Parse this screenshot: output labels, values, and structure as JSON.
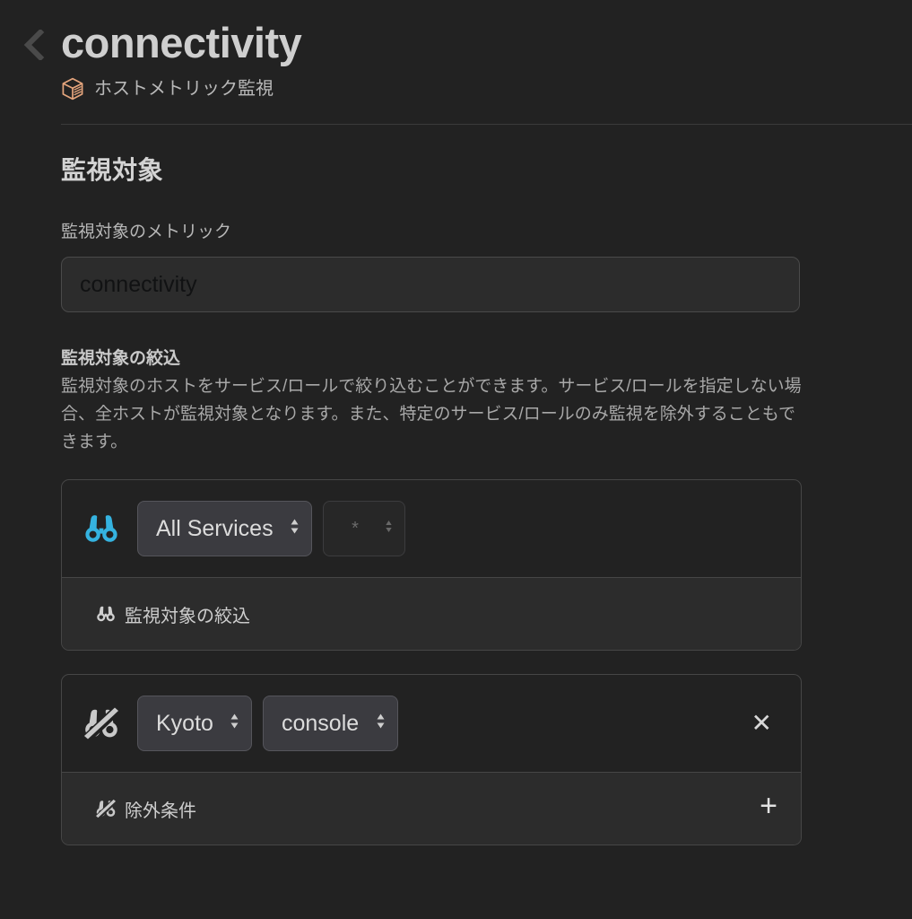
{
  "header": {
    "back_icon": "chevron-left-icon",
    "title": "connectivity",
    "badge_icon": "cube-icon",
    "badge_color": "#e5a57d",
    "subtitle": "ホストメトリック監視"
  },
  "main": {
    "section_title": "監視対象",
    "metric": {
      "label": "監視対象のメトリック",
      "value": "connectivity",
      "placeholder": "connectivity"
    },
    "scope": {
      "heading": "監視対象の絞込",
      "description": "監視対象のホストをサービス/ロールで絞り込むことができます。サービス/ロールを指定しない場合、全ホストが監視対象となります。また、特定のサービス/ロールのみ監視を除外することもできます。"
    },
    "include_panel": {
      "icon": "binoculars-icon",
      "icon_color": "#35b3e0",
      "service_value": "All Services",
      "role_value": "*",
      "role_disabled": true,
      "footer_icon": "binoculars-icon",
      "footer_label": "監視対象の絞込"
    },
    "exclude_panel": {
      "icon": "binoculars-slash-icon",
      "icon_color": "#c9c9c9",
      "service_value": "Kyoto",
      "role_value": "console",
      "remove_label": "✕",
      "footer_icon": "binoculars-slash-icon",
      "footer_label": "除外条件",
      "add_label": "+"
    }
  },
  "colors": {
    "background": "#222222",
    "panel_footer": "#2c2c2c",
    "border": "#464646",
    "accent_cyan": "#35b3e0",
    "accent_orange": "#e5a57d"
  }
}
